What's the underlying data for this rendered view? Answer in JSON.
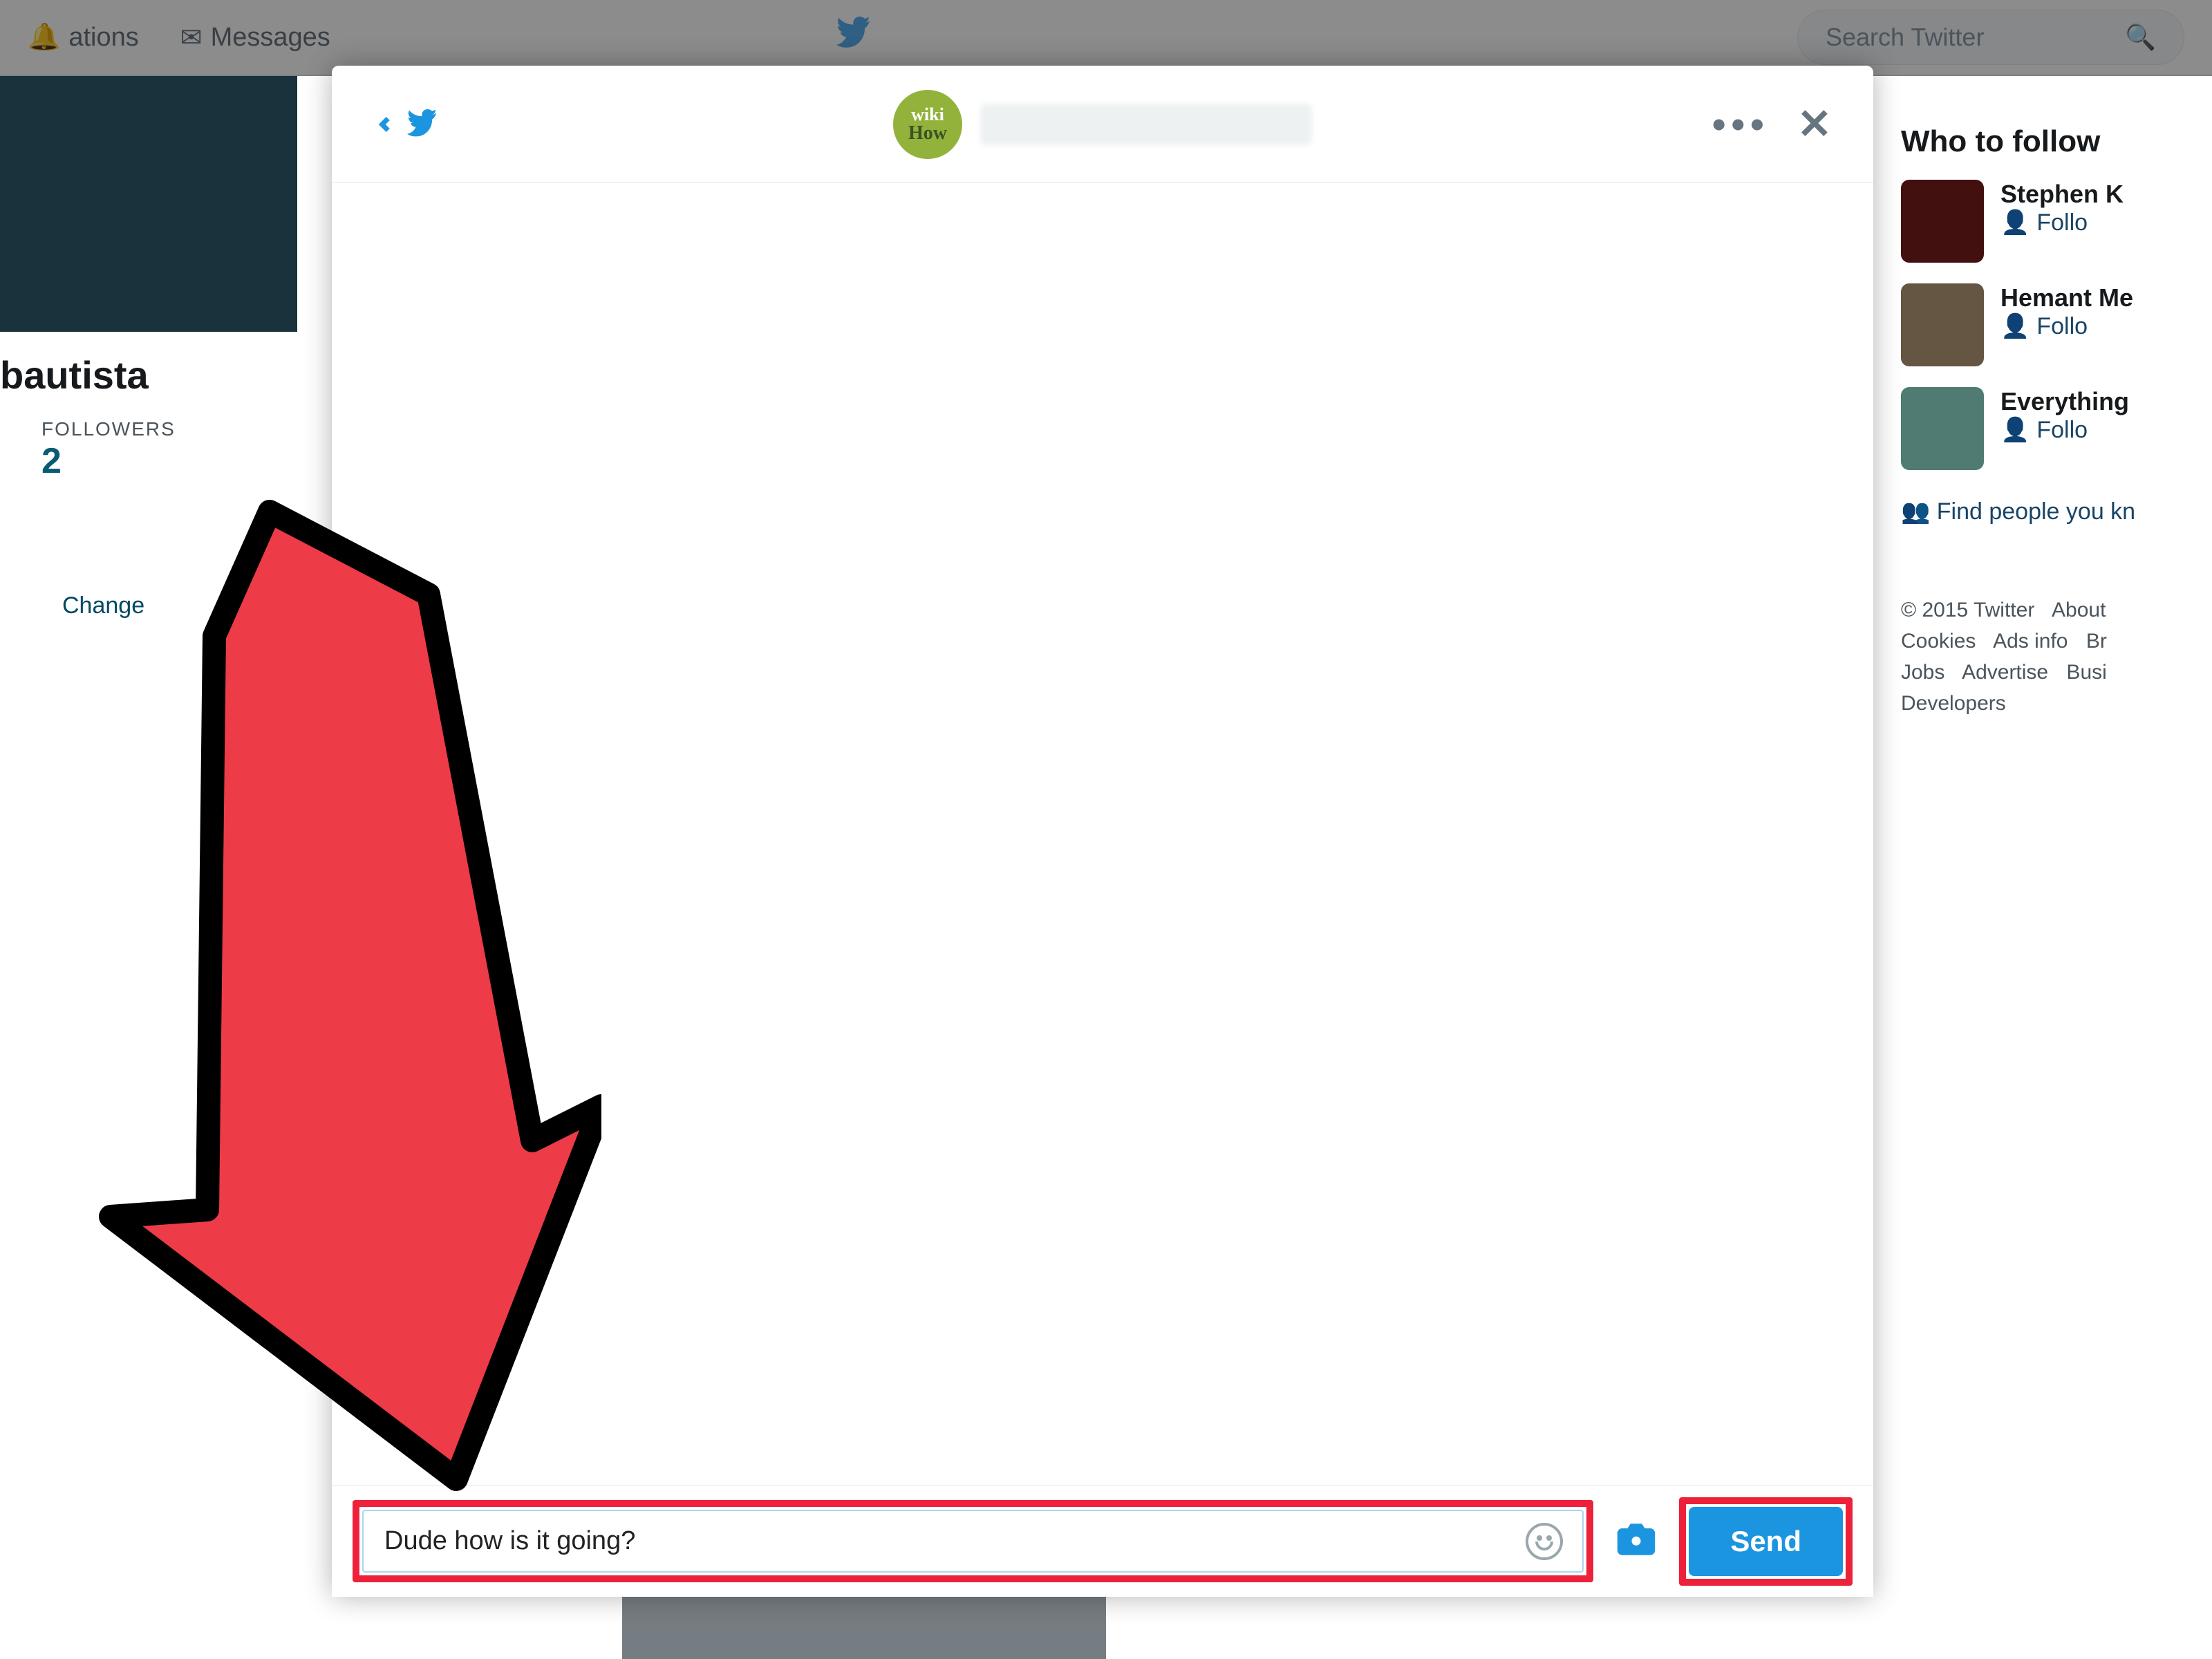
{
  "topbar": {
    "nav_notifications": "ations",
    "nav_messages": "Messages",
    "search_placeholder": "Search Twitter"
  },
  "profile": {
    "name": "bautista",
    "followers_label": "FOLLOWERS",
    "followers_count": "2",
    "change_link": "Change"
  },
  "who_to_follow": {
    "title": "Who to follow",
    "items": [
      {
        "name": "Stephen K",
        "action": "Follo"
      },
      {
        "name": "Hemant Me",
        "action": "Follo"
      },
      {
        "name": "Everything",
        "action": "Follo"
      }
    ],
    "find_people": "Find people you kn"
  },
  "footer": {
    "copyright": "© 2015 Twitter",
    "links": [
      "About",
      "Cookies",
      "Ads info",
      "Br",
      "Jobs",
      "Advertise",
      "Busi",
      "Developers"
    ]
  },
  "modal": {
    "avatar_badge_top": "wiki",
    "avatar_badge_bottom": "How",
    "input_value": "Dude how is it going?",
    "send_label": "Send"
  }
}
